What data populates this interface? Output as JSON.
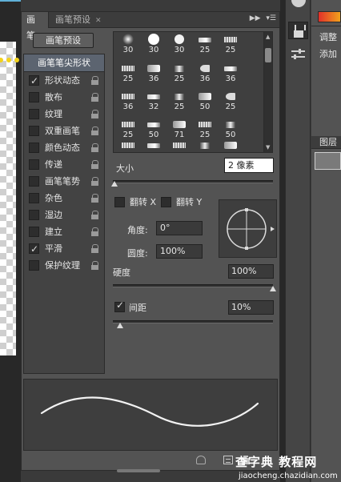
{
  "colors": {
    "panel_bg": "#535353",
    "selected_option": "#5c6470",
    "accent_line": "#5fb0d8"
  },
  "panel": {
    "tabs": [
      {
        "label": "画笔",
        "active": true
      },
      {
        "label": "画笔预设",
        "active": false
      }
    ],
    "menu_icons": [
      "collapse-arrows-icon",
      "panel-menu-icon"
    ],
    "preset_button": "画笔预设",
    "options": [
      {
        "label": "画笔笔尖形状",
        "checked": null,
        "lock": false,
        "selected": true
      },
      {
        "label": "形状动态",
        "checked": true,
        "lock": true
      },
      {
        "label": "散布",
        "checked": false,
        "lock": true
      },
      {
        "label": "纹理",
        "checked": false,
        "lock": true
      },
      {
        "label": "双重画笔",
        "checked": false,
        "lock": true
      },
      {
        "label": "颜色动态",
        "checked": false,
        "lock": true
      },
      {
        "label": "传递",
        "checked": false,
        "lock": true
      },
      {
        "label": "画笔笔势",
        "checked": false,
        "lock": true
      },
      {
        "label": "杂色",
        "checked": false,
        "lock": true
      },
      {
        "label": "湿边",
        "checked": false,
        "lock": true
      },
      {
        "label": "建立",
        "checked": false,
        "lock": true
      },
      {
        "label": "平滑",
        "checked": true,
        "lock": true
      },
      {
        "label": "保护纹理",
        "checked": false,
        "lock": true
      }
    ],
    "brush_tips": [
      [
        "30",
        "30",
        "30",
        "25",
        "25"
      ],
      [
        "25",
        "36",
        "25",
        "36",
        "36"
      ],
      [
        "36",
        "32",
        "25",
        "50",
        "25"
      ],
      [
        "25",
        "50",
        "71",
        "25",
        "50"
      ],
      [
        "",
        "",
        "",
        "",
        ""
      ]
    ],
    "size": {
      "label": "大小",
      "value": "2 像素",
      "slider_fraction": 0.01
    },
    "flip_x": {
      "label": "翻转 X",
      "checked": false
    },
    "flip_y": {
      "label": "翻转 Y",
      "checked": false
    },
    "angle": {
      "label": "角度:",
      "value": "0°"
    },
    "roundness": {
      "label": "圆度:",
      "value": "100%"
    },
    "hardness": {
      "label": "硬度",
      "value": "100%",
      "slider_fraction": 1.0
    },
    "spacing": {
      "label": "间距",
      "value": "10%",
      "checked": true,
      "slider_fraction": 0.05
    },
    "bottom_icons": [
      "toggle-preview-icon",
      "create-brush-icon",
      "delete-icon"
    ]
  },
  "right_panel": {
    "adjust_label": "调整",
    "add_label": "添加",
    "layers_label": "图层"
  },
  "watermark": {
    "main": "查字典 教程网",
    "sub": "jiaocheng.chazidian.com"
  }
}
